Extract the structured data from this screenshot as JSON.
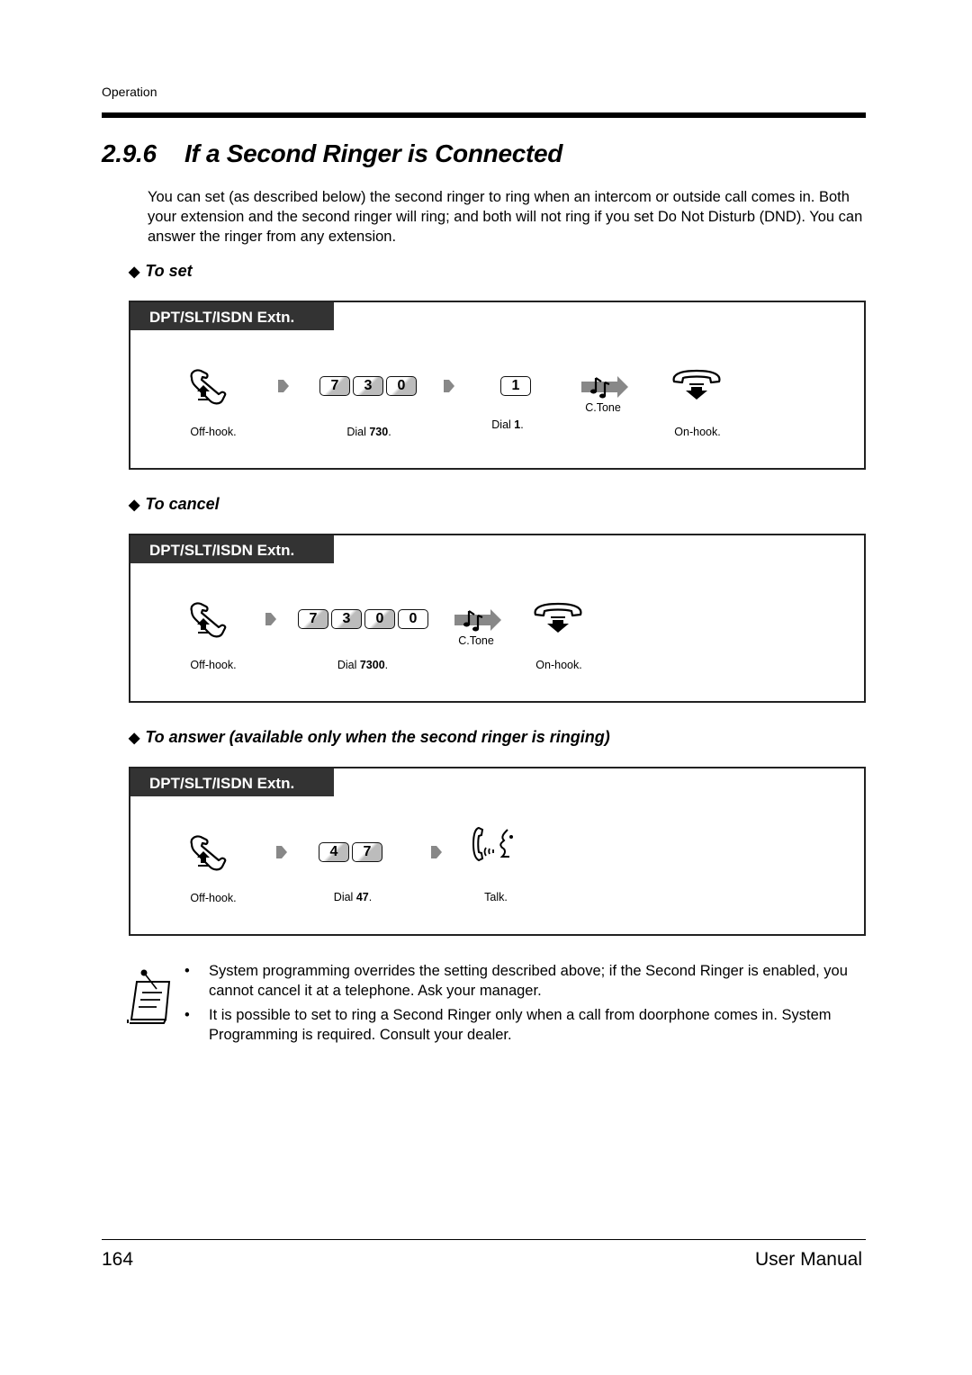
{
  "header": {
    "section": "Operation"
  },
  "title": {
    "number": "2.9.6",
    "text": "If a Second Ringer is Connected"
  },
  "intro": "You can set (as described below) the second ringer to ring when an intercom or outside call comes in. Both your extension and the second ringer will ring; and both will not ring if you set Do Not Disturb (DND). You can answer the ringer from any extension.",
  "sections": [
    {
      "heading": "To set",
      "tab": "DPT/SLT/ISDN Extn.",
      "steps": [
        {
          "icon": "off-hook-icon",
          "label": "Off-hook."
        },
        {
          "icon": "keys",
          "keys": [
            "7",
            "3",
            "0"
          ],
          "label_prefix": "Dial ",
          "label_bold": "730",
          "label_suffix": "."
        },
        {
          "icon": "keys",
          "keys": [
            "1"
          ],
          "label_prefix": "Dial ",
          "label_bold": "1",
          "label_suffix": "."
        },
        {
          "icon": "confirmation-tone-icon",
          "label": "C.Tone"
        },
        {
          "icon": "on-hook-icon",
          "label": "On-hook."
        }
      ]
    },
    {
      "heading": "To cancel",
      "tab": "DPT/SLT/ISDN Extn.",
      "steps": [
        {
          "icon": "off-hook-icon",
          "label": "Off-hook."
        },
        {
          "icon": "keys",
          "keys": [
            "7",
            "3",
            "0",
            "0"
          ],
          "label_prefix": "Dial ",
          "label_bold": "7300",
          "label_suffix": "."
        },
        {
          "icon": "confirmation-tone-icon",
          "label": "C.Tone"
        },
        {
          "icon": "on-hook-icon",
          "label": "On-hook."
        }
      ]
    },
    {
      "heading": "To answer (available only when the second ringer is ringing)",
      "tab": "DPT/SLT/ISDN Extn.",
      "steps": [
        {
          "icon": "off-hook-icon",
          "label": "Off-hook."
        },
        {
          "icon": "keys",
          "keys": [
            "4",
            "7"
          ],
          "label_prefix": "Dial ",
          "label_bold": "47",
          "label_suffix": "."
        },
        {
          "icon": "talk-icon",
          "label": "Talk."
        }
      ]
    }
  ],
  "notes": [
    "System programming overrides the setting described above; if the Second Ringer is enabled, you cannot cancel it at a telephone. Ask your manager.",
    "It is possible to set to ring a Second Ringer only when a call from doorphone comes in. System Programming is required. Consult your dealer."
  ],
  "footer": {
    "page": "164",
    "manual": "User Manual"
  }
}
